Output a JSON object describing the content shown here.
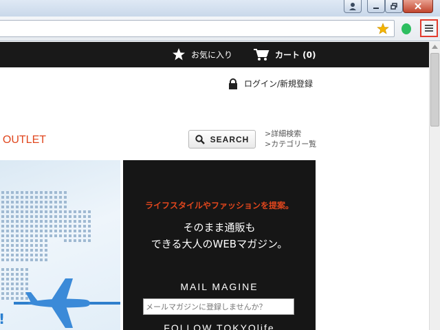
{
  "header": {
    "favorites_label": "お気に入り",
    "cart_label": "カート (0)",
    "login_label": "ログイン/新規登録"
  },
  "nav": {
    "outlet_label": "/ OUTLET"
  },
  "search": {
    "button_label": "SEARCH",
    "advanced_link": ">詳細検索",
    "category_link": ">カテゴリー覧"
  },
  "promo": {
    "tagline": "ライフスタイルやファッションを提案。",
    "headline_line1": "そのまま通販も",
    "headline_line2": "できる大人のWEBマガジン。",
    "mail_heading": "MAIL MAGINE",
    "mail_placeholder": "メールマガジンに登録しませんか？",
    "follow_heading": "FOLLOW TOKYOlife"
  },
  "hero": {
    "text_fragment": "!"
  },
  "colors": {
    "accent_orange": "#e0461d",
    "menu_highlight": "#e33a2c",
    "bookmark_star": "#f4b400"
  }
}
